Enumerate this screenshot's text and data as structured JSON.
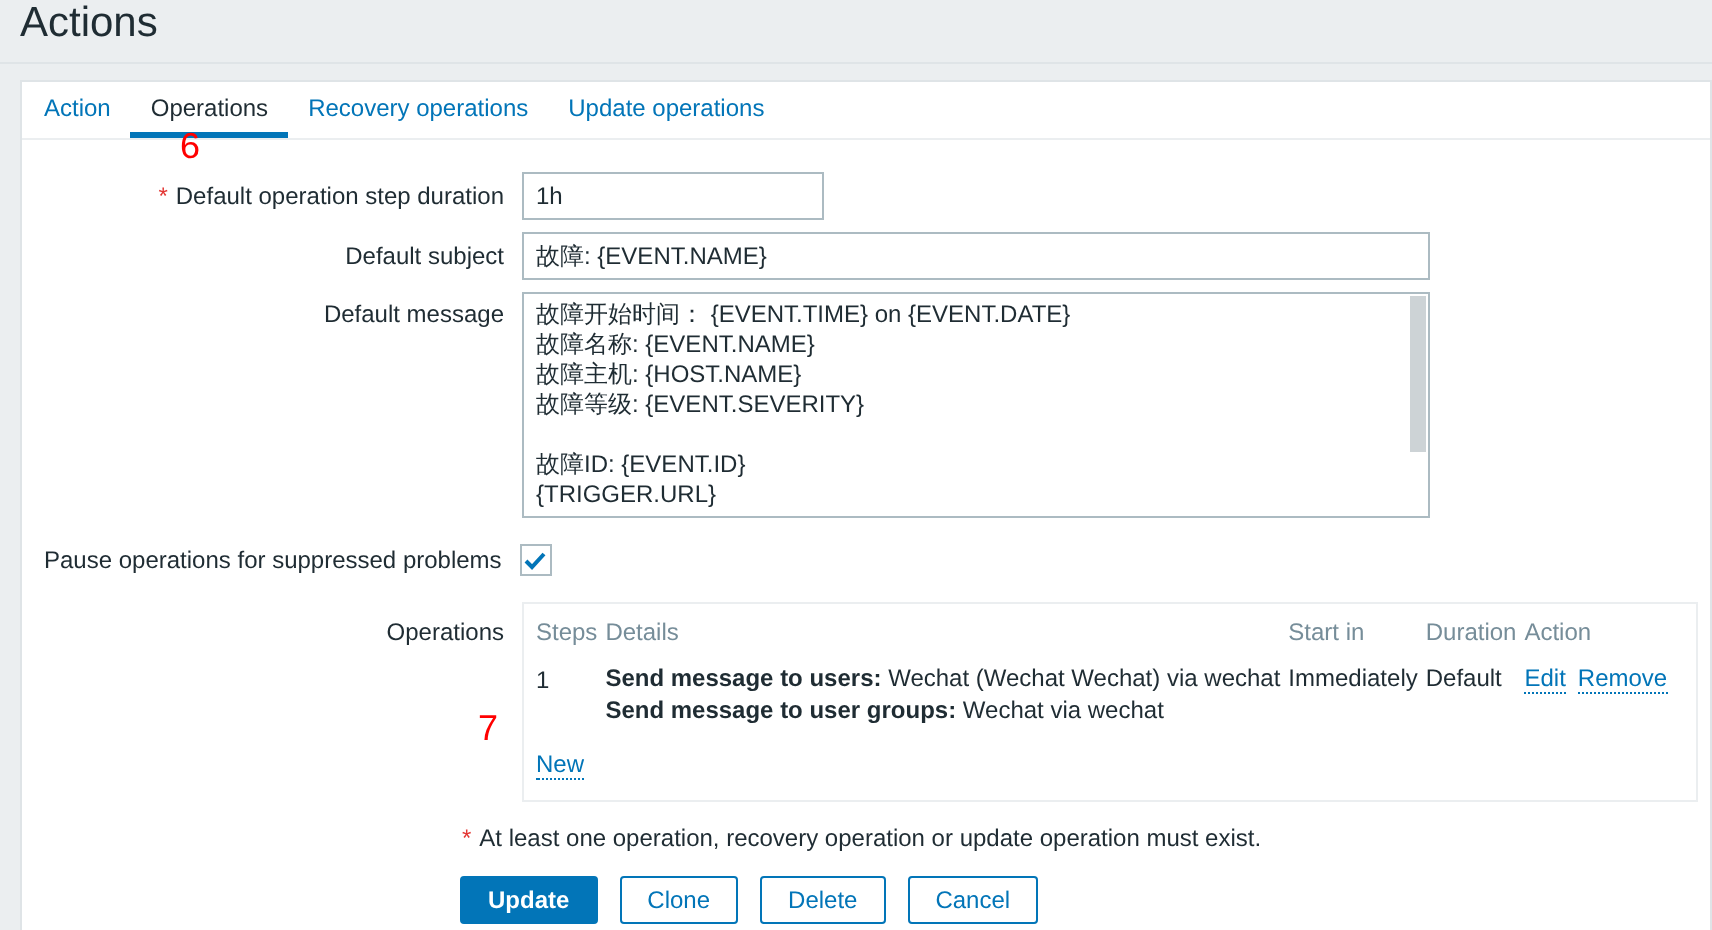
{
  "page_title": "Actions",
  "tabs": [
    {
      "label": "Action",
      "selected": false
    },
    {
      "label": "Operations",
      "selected": true
    },
    {
      "label": "Recovery operations",
      "selected": false
    },
    {
      "label": "Update operations",
      "selected": false
    }
  ],
  "annotations": [
    "6",
    "7"
  ],
  "required_mark": "*",
  "form": {
    "step_duration": {
      "label": "Default operation step duration",
      "required": true,
      "value": "1h"
    },
    "subject": {
      "label": "Default subject",
      "value": "故障: {EVENT.NAME}"
    },
    "message": {
      "label": "Default message",
      "paragraphs": [
        [
          "故障开始时间： {EVENT.TIME} on {EVENT.DATE}",
          "故障名称: {EVENT.NAME}",
          "故障主机: {HOST.NAME}",
          "故障等级: {EVENT.SEVERITY}"
        ],
        [
          "故障ID: {EVENT.ID}",
          "{TRIGGER.URL}"
        ]
      ]
    },
    "pause": {
      "label": "Pause operations for suppressed problems",
      "checked": true
    }
  },
  "operations": {
    "label": "Operations",
    "columns": [
      "Steps",
      "Details",
      "Start in",
      "Duration",
      "Action"
    ],
    "rows": [
      {
        "steps": "1",
        "details": [
          "**Send message to users:** Wechat (Wechat Wechat) via wechat",
          "**Send message to user groups:** Wechat via wechat"
        ],
        "start_in": "Immediately",
        "duration": "Default",
        "actions": [
          "Edit",
          "Remove"
        ]
      }
    ],
    "new_link": "New"
  },
  "note": {
    "text": "At least one operation, recovery operation or update operation must exist.",
    "required": true
  },
  "buttons": [
    {
      "label": "Update",
      "kind": "primary"
    },
    {
      "label": "Clone",
      "kind": "secondary"
    },
    {
      "label": "Delete",
      "kind": "secondary"
    },
    {
      "label": "Cancel",
      "kind": "secondary"
    }
  ]
}
